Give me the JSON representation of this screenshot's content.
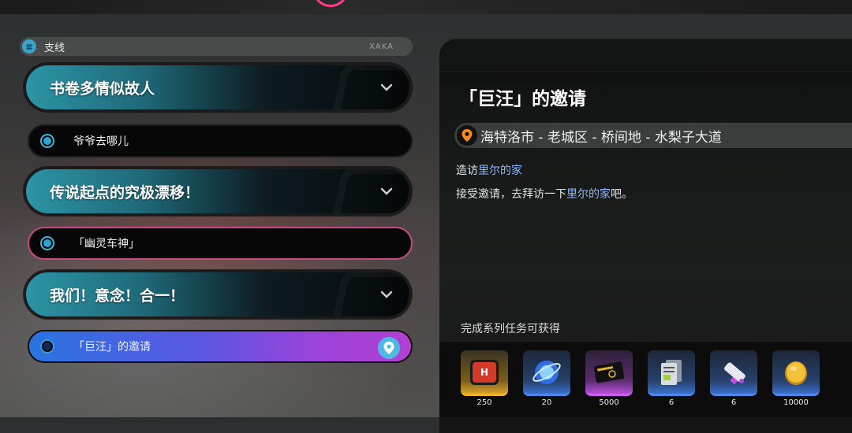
{
  "sidebar": {
    "header_label": "支线",
    "header_hint": "XAKA",
    "groups": [
      {
        "title": "书卷多情似故人",
        "subquest": "爷爷去哪儿"
      },
      {
        "title": "传说起点的究极漂移！",
        "subquest": "「幽灵车神」"
      },
      {
        "title": "我们！意念！合一！",
        "subquest": "「巨汪」的邀请"
      }
    ]
  },
  "detail": {
    "title": "「巨汪」的邀请",
    "location": "海特洛市 - 老城区 - 桥间地 - 水梨子大道",
    "objective_prefix": "造访",
    "objective_highlight": "里尔的家",
    "description_prefix": "接受邀请，去拜访一下",
    "description_highlight": "里尔的家",
    "description_suffix": "吧。",
    "rewards_label": "完成系列任务可获得",
    "rewards": [
      {
        "icon": "hunter-badge-icon",
        "qty": "250",
        "rarity": "gold"
      },
      {
        "icon": "polychrome-orb-icon",
        "qty": "20",
        "rarity": "blue"
      },
      {
        "icon": "black-card-icon",
        "qty": "5000",
        "rarity": "purple"
      },
      {
        "icon": "data-document-icon",
        "qty": "6",
        "rarity": "blue"
      },
      {
        "icon": "paint-tube-icon",
        "qty": "6",
        "rarity": "blue"
      },
      {
        "icon": "gold-coin-icon",
        "qty": "10000",
        "rarity": "blue"
      }
    ]
  },
  "colors": {
    "group_teal": "#2c95a6",
    "active_blue": "#2a73e0",
    "active_purple": "#b23fd2",
    "ghost_pink": "#c74a86",
    "location_orange": "#ff8a1e",
    "highlight_blue": "#8fb6ff"
  }
}
